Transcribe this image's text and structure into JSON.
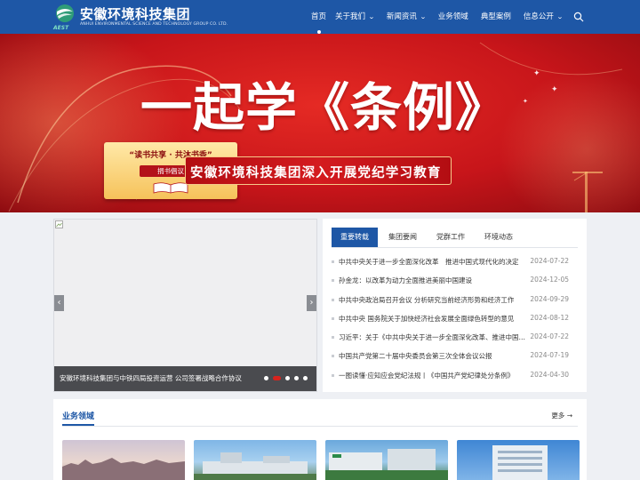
{
  "header": {
    "logo_cn": "安徽环境科技集团",
    "logo_en": "ANHUI ENVIRONMENTAL SCIENCE AND TECHNOLOGY GROUP CO. LTD.",
    "logo_tag": "AEST",
    "nav": [
      {
        "label": "首页",
        "dropdown": false,
        "active": true
      },
      {
        "label": "关于我们",
        "dropdown": true,
        "active": false
      },
      {
        "label": "新闻资讯",
        "dropdown": true,
        "active": false
      },
      {
        "label": "业务领域",
        "dropdown": false,
        "active": false
      },
      {
        "label": "典型案例",
        "dropdown": false,
        "active": false
      },
      {
        "label": "信息公开",
        "dropdown": true,
        "active": false
      }
    ]
  },
  "banner": {
    "title": "一起学《条例》",
    "subtitle": "安徽环境科技集团深入开展党纪学习教育",
    "book_card_title": "“读书共享 · 共沐书香”",
    "book_card_button": "捐书倡议",
    "slide_count": 8,
    "active_slide": 2
  },
  "slider": {
    "caption": "安徽环境科技集团与中铁四局投资运营 公司签署战略合作协议",
    "dot_count": 5,
    "active_dot": 2,
    "prev": "‹",
    "next": "›"
  },
  "news": {
    "tabs": [
      "重要转载",
      "集团要闻",
      "党群工作",
      "环境动态"
    ],
    "active_tab": 0,
    "items": [
      {
        "title": "中共中央关于进一步全面深化改革　推进中国式现代化的决定",
        "date": "2024-07-22"
      },
      {
        "title": "孙金龙：以改革为动力全面推进美丽中国建设",
        "date": "2024-12-05"
      },
      {
        "title": "中共中央政治局召开会议 分析研究当前经济形势和经济工作",
        "date": "2024-09-29"
      },
      {
        "title": "中共中央 国务院关于加快经济社会发展全面绿色转型的意见",
        "date": "2024-08-12"
      },
      {
        "title": "习近平：关于《中共中央关于进一步全面深化改革、推进中国式现代化的决定》的说明",
        "date": "2024-07-22"
      },
      {
        "title": "中国共产党第二十届中央委员会第三次全体会议公报",
        "date": "2024-07-19"
      },
      {
        "title": "一图读懂·应知应会党纪法规丨《中国共产党纪律处分条例》",
        "date": "2024-04-30"
      }
    ]
  },
  "business": {
    "title": "业务领域",
    "more": "更多"
  },
  "colors": {
    "primary": "#1e57a6",
    "banner_red": "#c7151a",
    "accent_red": "#d9231d"
  }
}
